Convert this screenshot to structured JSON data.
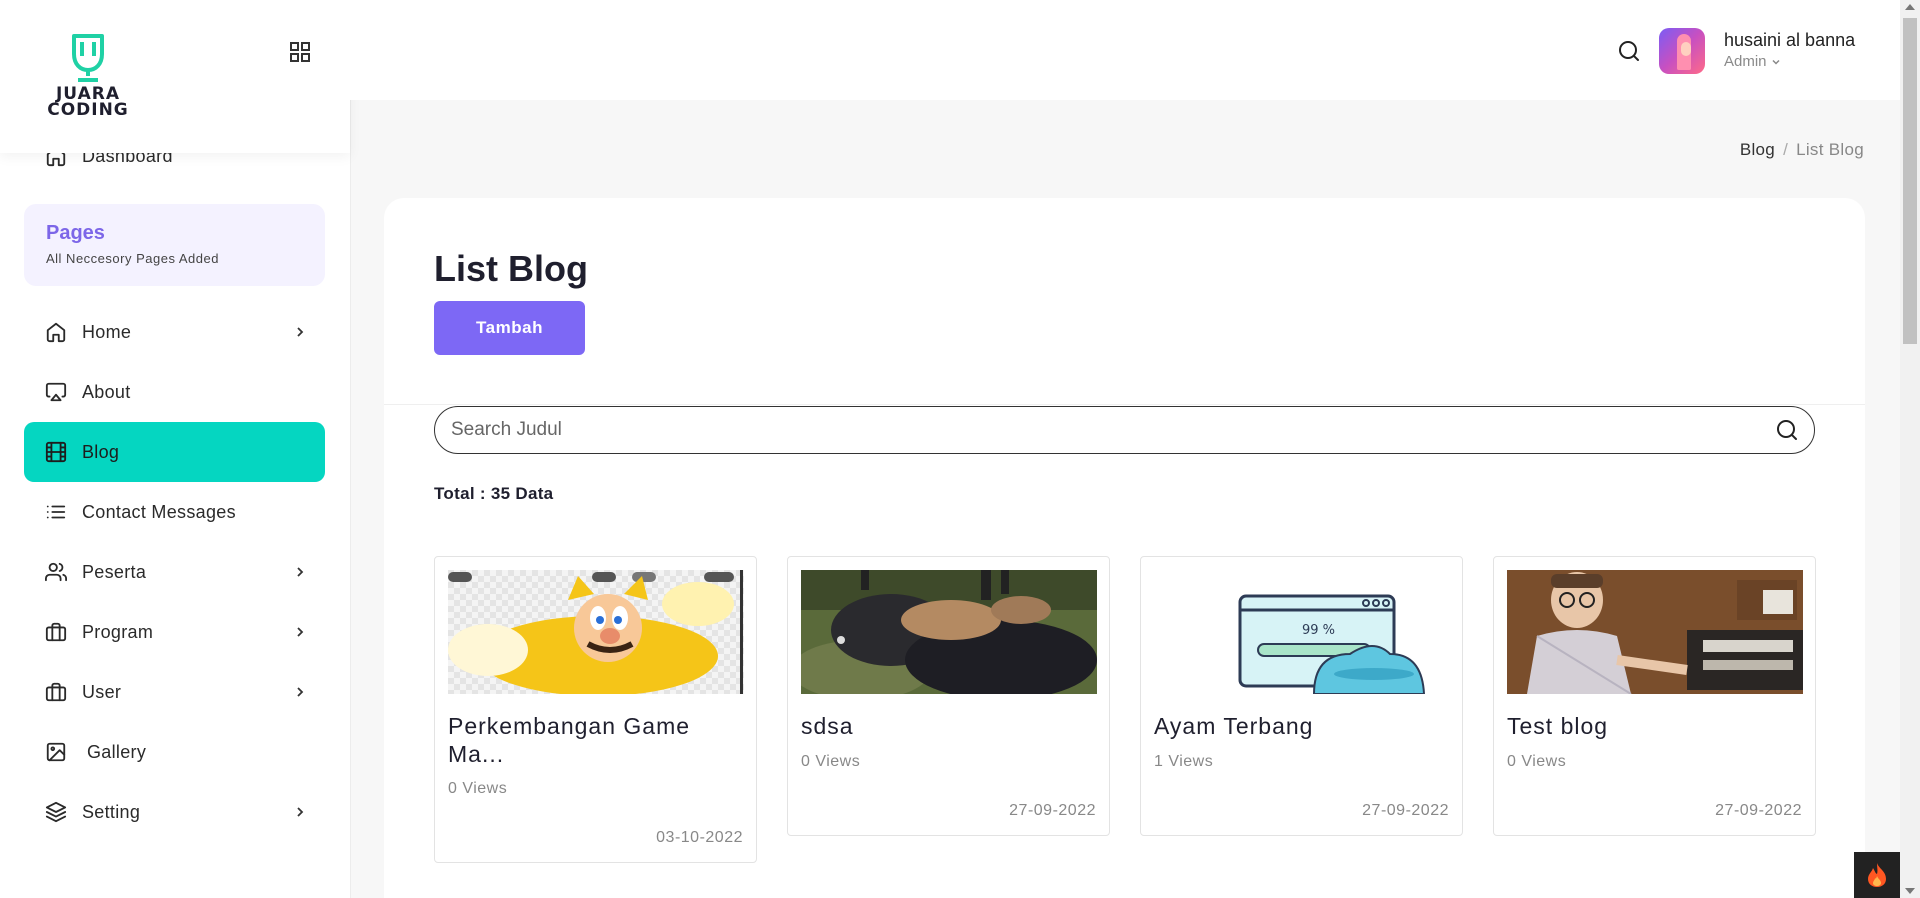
{
  "brand": {
    "line1": "JUARA",
    "line2": "CODING",
    "accent": "#1fd1a5"
  },
  "sidebar": {
    "top_item": {
      "label": "Dashboard",
      "icon": "home-icon"
    },
    "pages_box": {
      "title": "Pages",
      "subtitle": "All Neccesory Pages Added"
    },
    "items": [
      {
        "label": "Home",
        "icon": "home-icon",
        "has_submenu": true
      },
      {
        "label": "About",
        "icon": "airplay-icon",
        "has_submenu": false
      },
      {
        "label": "Blog",
        "icon": "film-icon",
        "has_submenu": false,
        "active": true
      },
      {
        "label": "Contact Messages",
        "icon": "list-icon",
        "has_submenu": false
      },
      {
        "label": "Peserta",
        "icon": "users-icon",
        "has_submenu": true
      },
      {
        "label": "Program",
        "icon": "briefcase-icon",
        "has_submenu": true
      },
      {
        "label": "User",
        "icon": "briefcase-icon",
        "has_submenu": true
      },
      {
        "label": "Gallery",
        "icon": "image-icon",
        "has_submenu": false
      },
      {
        "label": "Setting",
        "icon": "layers-icon",
        "has_submenu": true
      }
    ],
    "active_color": "#05d6c1"
  },
  "header": {
    "user_name": "husaini al banna",
    "user_role": "Admin"
  },
  "breadcrumb": {
    "parent": "Blog",
    "separator": "/",
    "current": "List Blog"
  },
  "main": {
    "title": "List Blog",
    "add_button": "Tambah",
    "search_placeholder": "Search Judul",
    "total_text": "Total : 35 Data",
    "button_color": "#7d68f5"
  },
  "blogs": [
    {
      "title": "Perkembangan Game Ma...",
      "views": "0 Views",
      "date": "03-10-2022",
      "thumb": "mario-cat-suit"
    },
    {
      "title": "sdsa",
      "views": "0 Views",
      "date": "27-09-2022",
      "thumb": "animals-on-ground"
    },
    {
      "title": "Ayam Terbang",
      "views": "1 Views",
      "date": "27-09-2022",
      "thumb": "loading-99-percent-illustration"
    },
    {
      "title": "Test blog",
      "views": "0 Views",
      "date": "27-09-2022",
      "thumb": "man-at-computer-vintage"
    }
  ]
}
